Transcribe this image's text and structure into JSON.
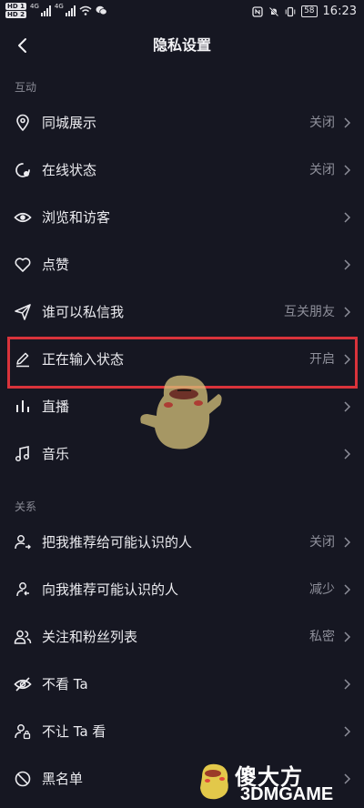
{
  "status_bar": {
    "hd1": "HD 1",
    "hd2": "HD 2",
    "net1": "4G",
    "net2": "4G",
    "battery": "58",
    "time": "16:23"
  },
  "header": {
    "title": "隐私设置"
  },
  "sections": {
    "interaction": "互动",
    "relations": "关系"
  },
  "rows": [
    {
      "label": "同城展示",
      "value": "关闭",
      "icon": "location-pin-icon"
    },
    {
      "label": "在线状态",
      "value": "关闭",
      "icon": "online-status-icon"
    },
    {
      "label": "浏览和访客",
      "value": "",
      "icon": "eye-icon"
    },
    {
      "label": "点赞",
      "value": "",
      "icon": "heart-icon"
    },
    {
      "label": "谁可以私信我",
      "value": "互关朋友",
      "icon": "send-icon"
    },
    {
      "label": "正在输入状态",
      "value": "开启",
      "icon": "pencil-icon"
    },
    {
      "label": "直播",
      "value": "",
      "icon": "live-bars-icon"
    },
    {
      "label": "音乐",
      "value": "",
      "icon": "music-note-icon"
    },
    {
      "label": "把我推荐给可能认识的人",
      "value": "关闭",
      "icon": "user-share-icon"
    },
    {
      "label": "向我推荐可能认识的人",
      "value": "减少",
      "icon": "user-recommend-icon"
    },
    {
      "label": "关注和粉丝列表",
      "value": "私密",
      "icon": "users-icon"
    },
    {
      "label": "不看 Ta",
      "value": "",
      "icon": "eye-off-icon"
    },
    {
      "label": "不让 Ta 看",
      "value": "",
      "icon": "user-lock-icon"
    },
    {
      "label": "黑名单",
      "value": "",
      "icon": "block-icon"
    }
  ],
  "watermark": {
    "brand": "傻大方",
    "sub": "3DMGAME"
  },
  "colors": {
    "background": "#161722",
    "highlight": "#d9333b",
    "text": "#ececf0",
    "muted": "#8e8f9a"
  }
}
